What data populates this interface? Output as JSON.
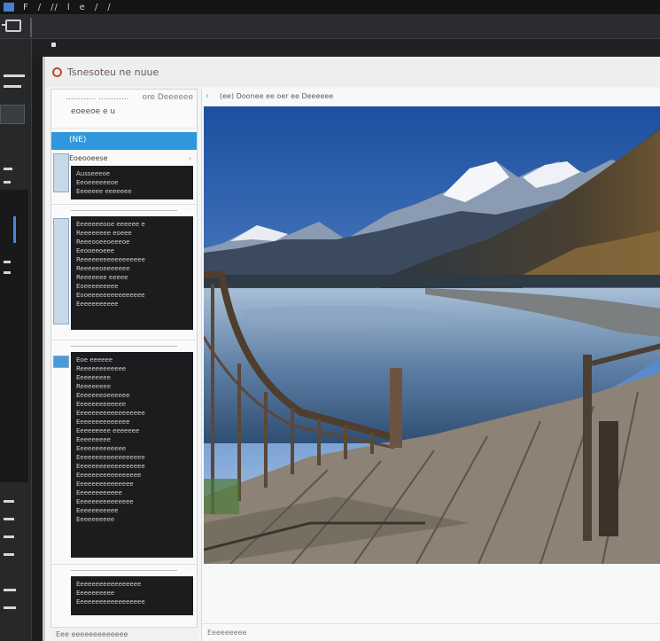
{
  "top_strip": {
    "menu_items": [
      "F",
      "/",
      "//",
      "l",
      "e",
      "/",
      "/"
    ],
    "accent": "#4a7fd0"
  },
  "window": {
    "title": "Tsnesoteu ne nuue"
  },
  "sidebar": {
    "header_line1": "............ ............",
    "header_right": "ore Deeeeee",
    "header_line2": "eoeeoe e u",
    "selected_label": "(NE)",
    "group1_title": "Eoeooeese",
    "group1_lines": [
      "Ausseeeoe",
      "Eeoeeeeeeoe",
      "Eeeeeee eeeeeee"
    ],
    "group2_lines": [
      "Eeeeeeeooe eeeeee e",
      "Reeeeeeee eoeee",
      "Reeeooeeoeeeoe",
      "Eeooeeoeee",
      "Reeeeeeeeeeeeeeeee",
      "Reeeeeoeeeeeee",
      "Reeeeeee eeeee",
      "Eoeeeeeeeee",
      "Eooeeeeeeeeeeeeeee",
      "Eeeeeeeeeee"
    ],
    "group3_lines": [
      "Eoe eeeeee",
      "Reeeeeeeeeeee",
      "Eeeeeeeee",
      "Reeeeeeee",
      "Eeeeeeeoeeeeee",
      "Eeeeeeeeeeeee",
      "Eeeeeeeeeeeeeeeeee",
      "Eeeeeeeeeeeeee",
      "Eeeeeeeee eeeeeee",
      "Eeeeeeeee",
      "Eeeeeeeeeeeee",
      "Eeeeeeeeeeeeeeeeee",
      "Eeeeeeeeeeeeeeeeee",
      "Eeeeeeeeeeeeeeeee",
      "Eeeeeeeeeeeeeee",
      "Eeeeeeeeeeee",
      "Eeeeeeeeeeeeeee",
      "Eeeeeeeeeee",
      "Eeeeeeeeee"
    ],
    "group4_lines": [
      "Eeeeeeeeeeeeeeeee",
      "Eeeeeeeeee",
      "Eeeeeeeeeeeeeeeeee"
    ],
    "footer": "Eee eeeeeeeeeeeee"
  },
  "viewer": {
    "header": "(ee) Doonee ee oer ee Deeeeee",
    "footer": "Eeeeeeeee"
  },
  "colors": {
    "selection": "#2f98dd",
    "sky_top": "#1d4f9f",
    "sky_bottom": "#a7c4e6",
    "lake": "#6f8fb3",
    "deck": "#8c8275"
  }
}
